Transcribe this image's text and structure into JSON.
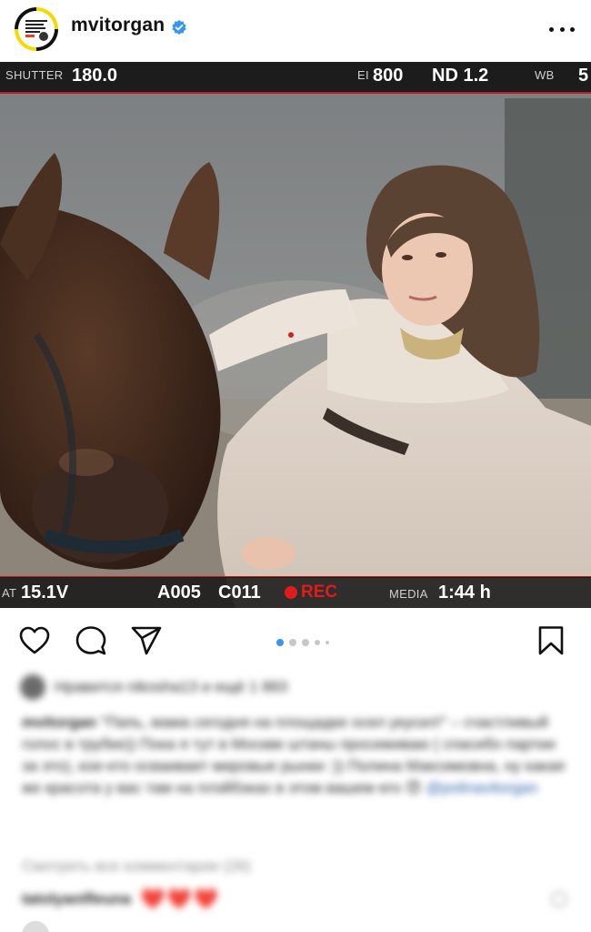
{
  "post": {
    "username": "mvitorgan",
    "verified": true
  },
  "camera_hud": {
    "shutter_label": "SHUTTER",
    "shutter_value": "180.0",
    "ei_label": "EI",
    "ei_value": "800",
    "nd_value": "ND 1.2",
    "wb_label": "WB",
    "wb_value": "5",
    "at_label": "AT",
    "voltage": "15.1V",
    "reel": "A005",
    "clip": "C011",
    "rec": "REC",
    "media_label": "MEDIA",
    "media_value": "1:44 h"
  },
  "carousel": {
    "count": 5,
    "active_index": 0
  },
  "likes": {
    "text": "Нравится nikosha13 и ещё 1 883"
  },
  "caption": {
    "user": "mvitorgan",
    "text": "\"Папь, мама сегодня на площадке осел укусил!\" – счастливый голос в трубке)) Пока я тут в Москве штаны просиживаю ( спасибо партии за это), кое-кто осваивает мировые рынки :)) Полина Максимовна, ну какая же красота у вас там на плэйбэках в этом вашем его 😍",
    "mention": "@polinavitorgan"
  },
  "view_comments": "Смотреть все комментарии (26)",
  "comment": {
    "user": "tatolyanifleuna",
    "hearts": "❤️❤️❤️"
  },
  "colors": {
    "accent_blue": "#3797f0",
    "rec_red": "#e01b1b",
    "hud_line": "#c21d1d"
  },
  "icons": [
    "heart-icon",
    "comment-icon",
    "share-icon",
    "bookmark-icon",
    "more-icon",
    "verified-icon"
  ]
}
